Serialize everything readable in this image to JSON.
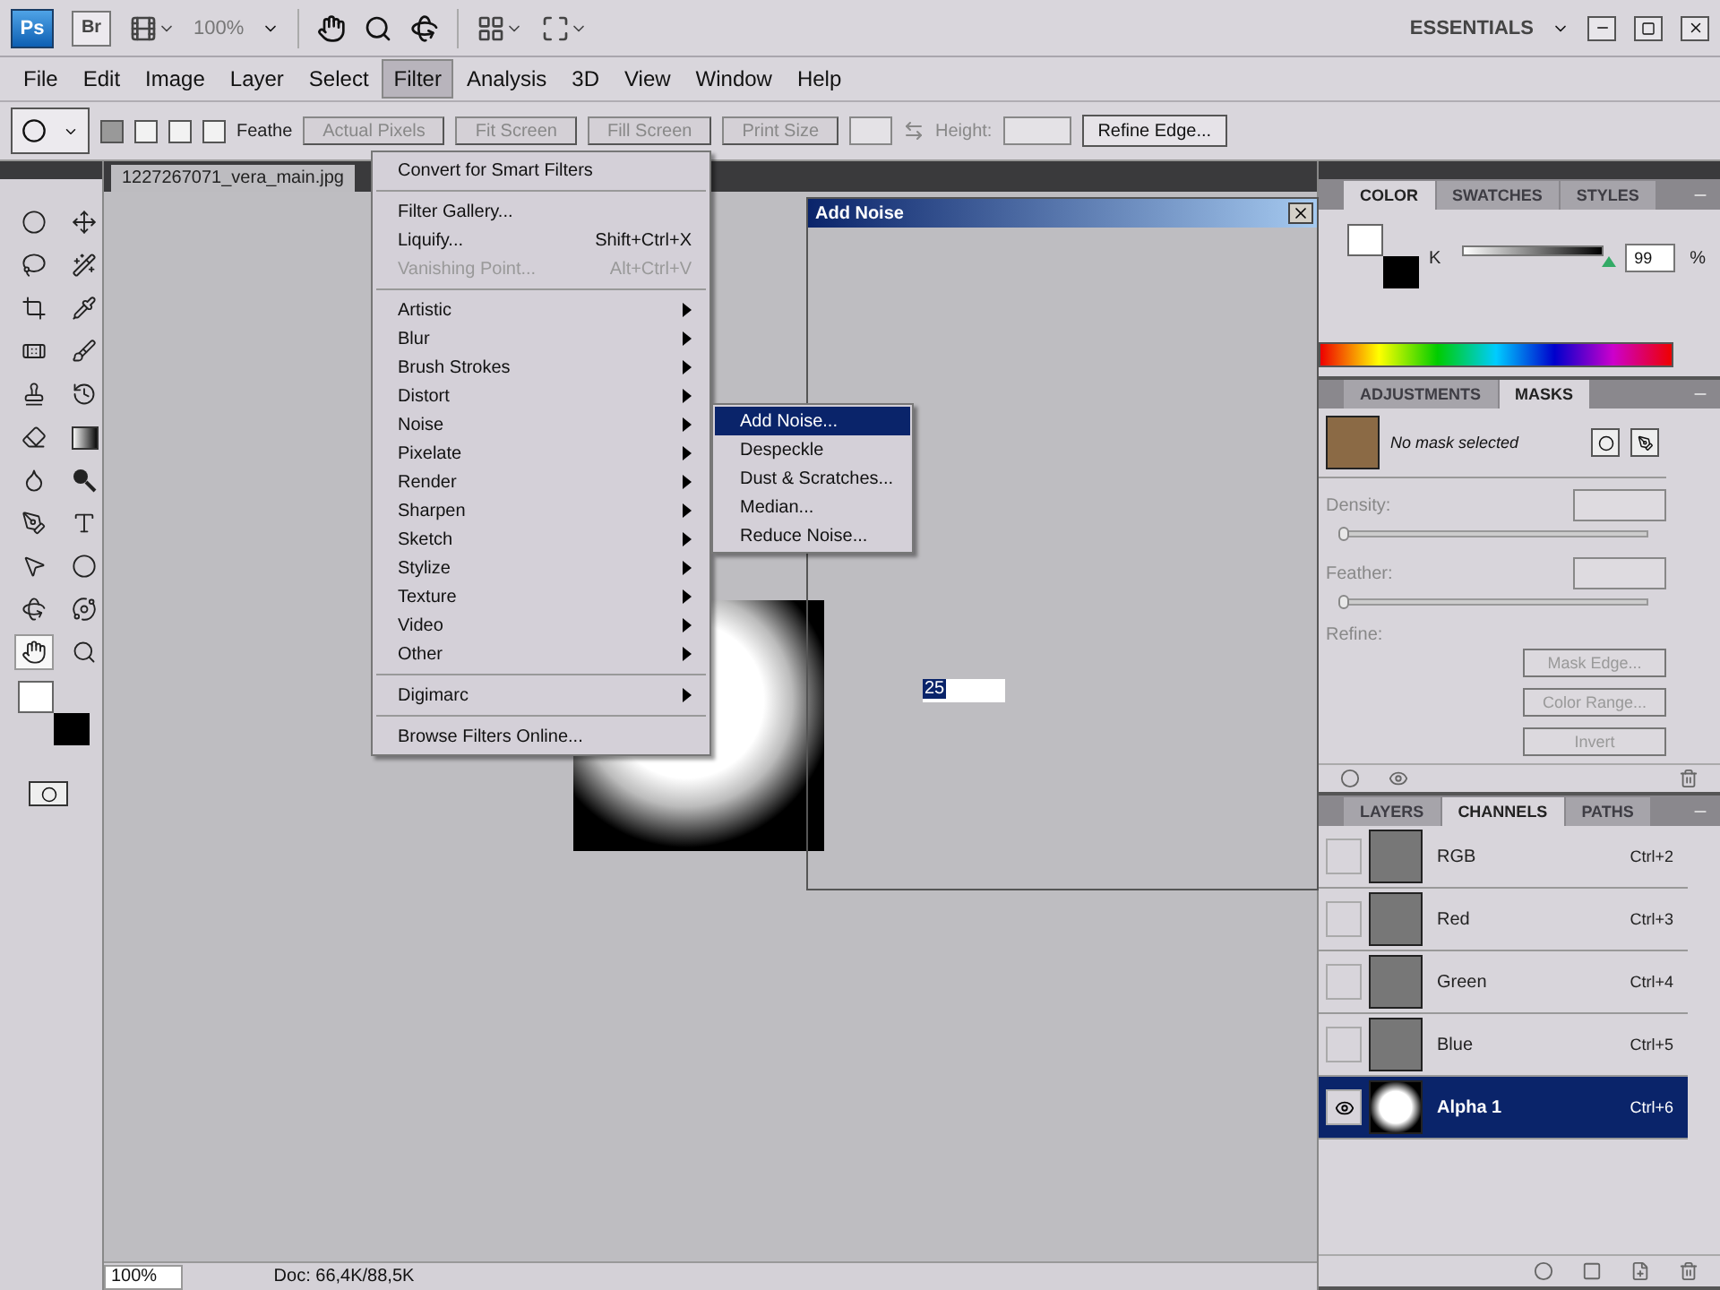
{
  "app_bar": {
    "logo": "Ps",
    "bridge": "Br",
    "zoom": "100%",
    "workspace": "ESSENTIALS"
  },
  "menu_bar": [
    {
      "label": "File",
      "selected": false
    },
    {
      "label": "Edit",
      "selected": false
    },
    {
      "label": "Image",
      "selected": false
    },
    {
      "label": "Layer",
      "selected": false
    },
    {
      "label": "Select",
      "selected": false
    },
    {
      "label": "Filter",
      "selected": true
    },
    {
      "label": "Analysis",
      "selected": false
    },
    {
      "label": "3D",
      "selected": false
    },
    {
      "label": "View",
      "selected": false
    },
    {
      "label": "Window",
      "selected": false
    },
    {
      "label": "Help",
      "selected": false
    }
  ],
  "options_bar": {
    "feather_label": "Feathe",
    "buttons": [
      "Actual Pixels",
      "Fit Screen",
      "Fill Screen",
      "Print Size"
    ],
    "height_label": "Height:",
    "refine_button": "Refine Edge...",
    "modes": [
      {
        "selected": true
      },
      {
        "selected": false
      },
      {
        "selected": false
      },
      {
        "selected": false
      }
    ]
  },
  "tools": [
    {
      "kind": "ellipse-marquee",
      "selected": false
    },
    {
      "kind": "move",
      "selected": false
    },
    {
      "kind": "lasso",
      "selected": false
    },
    {
      "kind": "wand",
      "selected": false
    },
    {
      "kind": "crop",
      "selected": false
    },
    {
      "kind": "eyedropper",
      "selected": false
    },
    {
      "kind": "bandage",
      "selected": false
    },
    {
      "kind": "brush",
      "selected": false
    },
    {
      "kind": "stamp",
      "selected": false
    },
    {
      "kind": "history",
      "selected": false
    },
    {
      "kind": "eraser",
      "selected": false
    },
    {
      "kind": "gradient",
      "selected": false
    },
    {
      "kind": "drop",
      "selected": false
    },
    {
      "kind": "dodge",
      "selected": false
    },
    {
      "kind": "pen",
      "selected": false
    },
    {
      "kind": "type",
      "selected": false
    },
    {
      "kind": "pointer",
      "selected": false
    },
    {
      "kind": "ellipse",
      "selected": false
    },
    {
      "kind": "rotate",
      "selected": false
    },
    {
      "kind": "orbit",
      "selected": false
    },
    {
      "kind": "hand",
      "selected": true
    },
    {
      "kind": "zoom",
      "selected": false
    }
  ],
  "document": {
    "tab": "1227267071_vera_main.jpg",
    "zoom": "100%",
    "doc_info": "Doc: 66,4K/88,5K"
  },
  "filter_menu": [
    {
      "kind": "item",
      "label": "Convert for Smart Filters",
      "disabled": false
    },
    {
      "kind": "separator"
    },
    {
      "kind": "item",
      "label": "Filter Gallery...",
      "disabled": false
    },
    {
      "kind": "item",
      "label": "Liquify...",
      "shortcut": "Shift+Ctrl+X",
      "disabled": false
    },
    {
      "kind": "item",
      "label": "Vanishing Point...",
      "shortcut": "Alt+Ctrl+V",
      "disabled": true
    },
    {
      "kind": "separator"
    },
    {
      "kind": "submenu",
      "label": "Artistic"
    },
    {
      "kind": "submenu",
      "label": "Blur"
    },
    {
      "kind": "submenu",
      "label": "Brush Strokes"
    },
    {
      "kind": "submenu",
      "label": "Distort"
    },
    {
      "kind": "submenu",
      "label": "Noise"
    },
    {
      "kind": "submenu",
      "label": "Pixelate"
    },
    {
      "kind": "submenu",
      "label": "Render"
    },
    {
      "kind": "submenu",
      "label": "Sharpen"
    },
    {
      "kind": "submenu",
      "label": "Sketch"
    },
    {
      "kind": "submenu",
      "label": "Stylize"
    },
    {
      "kind": "submenu",
      "label": "Texture"
    },
    {
      "kind": "submenu",
      "label": "Video"
    },
    {
      "kind": "submenu",
      "label": "Other"
    },
    {
      "kind": "separator"
    },
    {
      "kind": "submenu",
      "label": "Digimarc"
    },
    {
      "kind": "separator"
    },
    {
      "kind": "item",
      "label": "Browse Filters Online...",
      "disabled": false
    }
  ],
  "noise_submenu": [
    {
      "label": "Add Noise...",
      "selected": true
    },
    {
      "label": "Despeckle",
      "selected": false
    },
    {
      "label": "Dust & Scratches...",
      "selected": false
    },
    {
      "label": "Median...",
      "selected": false
    },
    {
      "label": "Reduce Noise...",
      "selected": false
    }
  ],
  "dialog": {
    "title": "Add Noise",
    "amount": "25"
  },
  "color_panel": {
    "tabs": [
      {
        "label": "COLOR",
        "selected": true
      },
      {
        "label": "SWATCHES",
        "selected": false
      },
      {
        "label": "STYLES",
        "selected": false
      }
    ],
    "channel": "K",
    "level": 0.99,
    "value": "99",
    "unit": "%"
  },
  "masks_panel": {
    "tabs": [
      {
        "label": "ADJUSTMENTS",
        "selected": false
      },
      {
        "label": "MASKS",
        "selected": true
      }
    ],
    "status": "No mask selected",
    "density": {
      "label": "Density:",
      "level": 0
    },
    "feather": {
      "label": "Feather:",
      "level": 0
    },
    "refine_label": "Refine:",
    "buttons": [
      "Mask Edge...",
      "Color Range...",
      "Invert"
    ]
  },
  "channels_panel": {
    "tabs": [
      {
        "label": "LAYERS",
        "selected": false
      },
      {
        "label": "CHANNELS",
        "selected": true
      },
      {
        "label": "PATHS",
        "selected": false
      }
    ],
    "channels": [
      {
        "kind": "photo",
        "name": "RGB",
        "shortcut": "Ctrl+2",
        "visible": false,
        "selected": false
      },
      {
        "kind": "photo",
        "name": "Red",
        "shortcut": "Ctrl+3",
        "visible": false,
        "selected": false
      },
      {
        "kind": "photo",
        "name": "Green",
        "shortcut": "Ctrl+4",
        "visible": false,
        "selected": false
      },
      {
        "kind": "photo",
        "name": "Blue",
        "shortcut": "Ctrl+5",
        "visible": false,
        "selected": false
      },
      {
        "kind": "alpha",
        "name": "Alpha 1",
        "shortcut": "Ctrl+6",
        "visible": true,
        "selected": true
      }
    ]
  }
}
